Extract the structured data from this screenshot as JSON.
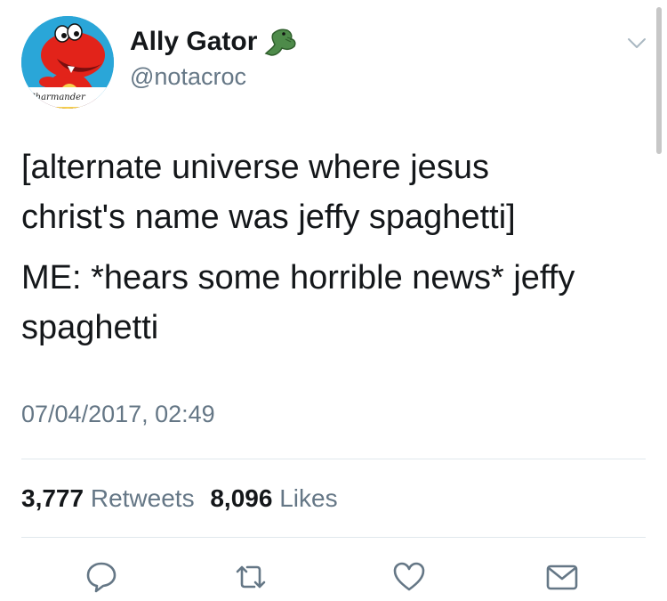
{
  "user": {
    "display_name": "Ally Gator",
    "handle": "@notacroc",
    "avatar_caption": "Charmander"
  },
  "tweet": {
    "paragraphs": [
      "[alternate universe where jesus\nchrist's name was jeffy spaghetti]",
      "ME: *hears some horrible news* jeffy\nspaghetti"
    ],
    "timestamp": "07/04/2017, 02:49"
  },
  "stats": {
    "retweets_count": "3,777",
    "retweets_label": "Retweets",
    "likes_count": "8,096",
    "likes_label": "Likes"
  },
  "icons": {
    "name_emoji": "crocodile-icon",
    "menu": "chevron-down-icon",
    "actions": [
      "reply-icon",
      "retweet-icon",
      "like-icon",
      "share-icon"
    ]
  },
  "colors": {
    "text": "#14171a",
    "secondary": "#657786",
    "divider": "#e1e8ed",
    "avatar_bg": "#2aa6d8"
  }
}
